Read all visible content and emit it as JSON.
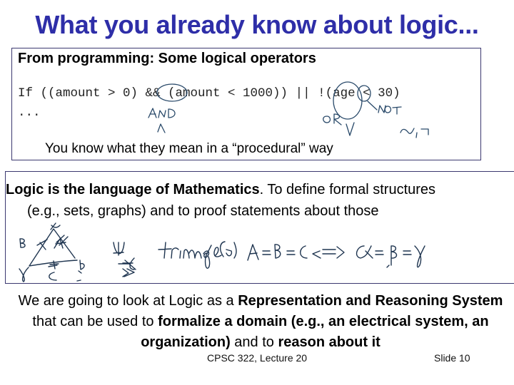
{
  "slide": {
    "title": "What you already know about logic...",
    "box1": {
      "heading": "From programming: Some logical operators",
      "code_line": "If ((amount > 0) && (amount < 1000)) || !(age < 30)",
      "ellipsis": "...",
      "note": "You know what they mean in a “procedural” way",
      "annotations": {
        "and_label": "AND",
        "and_symbol": "∧",
        "or_label": "OR",
        "or_symbol": "∨",
        "not_label": "NOT",
        "not_symbol": "~, ¬"
      }
    },
    "box2": {
      "line1_bold": "Logic is the language of Mathematics",
      "line1_rest": ". To define formal structures",
      "line2": "(e.g., sets, graphs) and to proof statements about those",
      "handwritten_formula": "∀x triangle(x) A=B=C ⇔ α=β=γ",
      "triangle_labels": [
        "α",
        "A",
        "B",
        "β",
        "γ",
        "C"
      ]
    },
    "conclusion": {
      "t1": "We are going to look at Logic as a ",
      "b1": "Representation and Reasoning System",
      "t2": " that can be used to ",
      "b2": "formalize a domain (e.g., an electrical system, an organization)",
      "t3": " and to ",
      "b3": "reason about it"
    },
    "footer": {
      "course": "CPSC 322, Lecture 20",
      "slide": "Slide 10"
    }
  },
  "colors": {
    "title": "#2e2ea8",
    "box_border": "#3b3870",
    "ink": "#2a4a6a"
  }
}
